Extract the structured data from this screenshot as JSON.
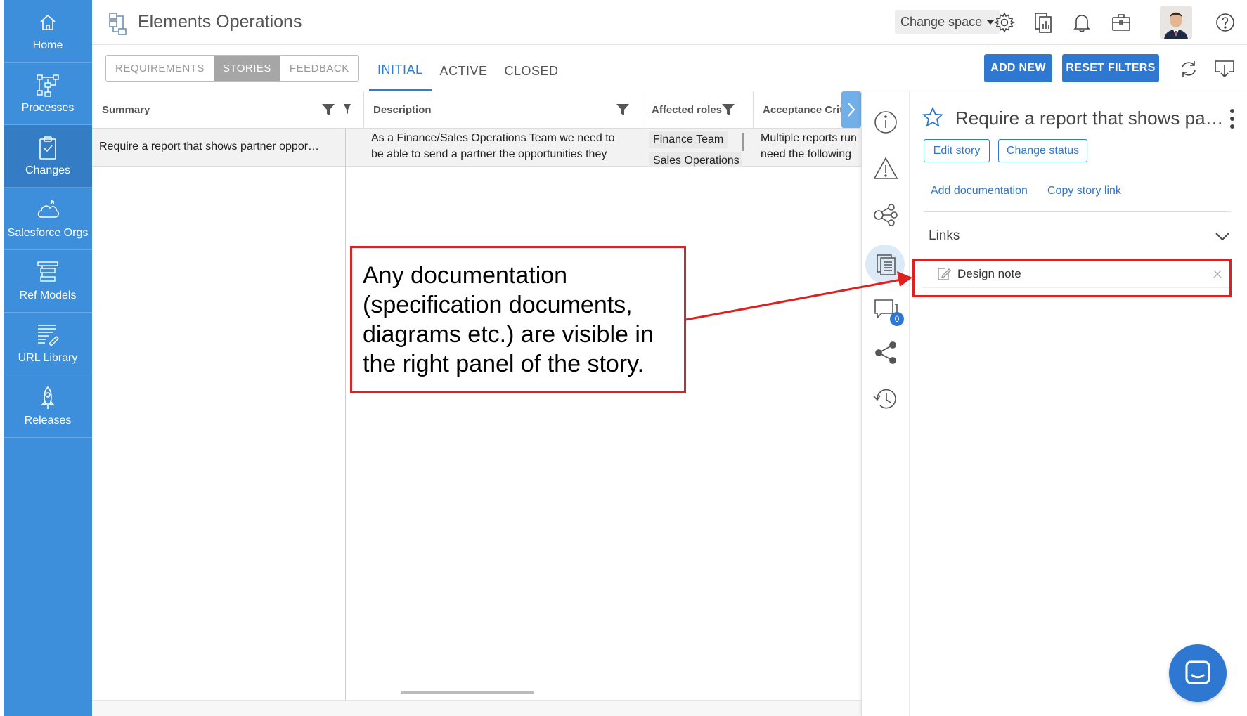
{
  "sidebar": {
    "items": [
      {
        "label": "Home",
        "icon": "home-icon"
      },
      {
        "label": "Processes",
        "icon": "processes-icon"
      },
      {
        "label": "Changes",
        "icon": "clipboard-check-icon",
        "active": true
      },
      {
        "label": "Salesforce Orgs",
        "icon": "cloud-icon"
      },
      {
        "label": "Ref Models",
        "icon": "ref-models-icon"
      },
      {
        "label": "URL Library",
        "icon": "url-library-icon"
      },
      {
        "label": "Releases",
        "icon": "rocket-icon"
      }
    ],
    "color": "#3d8fdc"
  },
  "header": {
    "title": "Elements Operations",
    "change_space": "Change space",
    "icons": [
      "gear-icon",
      "documents-icon",
      "bell-icon",
      "briefcase-icon",
      "avatar",
      "help-icon"
    ]
  },
  "toolbar": {
    "segments": [
      {
        "label": "REQUIREMENTS",
        "selected": false
      },
      {
        "label": "STORIES",
        "selected": true
      },
      {
        "label": "FEEDBACK",
        "selected": false
      }
    ],
    "tabs": [
      {
        "label": "INITIAL",
        "selected": true
      },
      {
        "label": "ACTIVE",
        "selected": false
      },
      {
        "label": "CLOSED",
        "selected": false
      }
    ],
    "add_new": "ADD NEW",
    "reset_filters": "RESET FILTERS",
    "accent": "#2f78d1"
  },
  "table": {
    "columns": [
      "Summary",
      "Description",
      "Affected roles",
      "Acceptance Criteri"
    ],
    "rows": [
      {
        "summary": "Require a report that shows partner oppor…",
        "description_line1": "As a Finance/Sales Operations Team we need to",
        "description_line2": "be able to send a partner the opportunities they",
        "role1": "Finance Team",
        "role2": "Sales Operations",
        "acceptance_line1": "Multiple reports run",
        "acceptance_line2": "need the following"
      }
    ]
  },
  "panel": {
    "story_title": "Require a report that shows partner opportunities",
    "edit_story": "Edit story",
    "change_status": "Change status",
    "add_documentation": "Add documentation",
    "copy_story_link": "Copy story link",
    "links_label": "Links",
    "links": [
      {
        "name": "Design note"
      }
    ],
    "comment_count": "0",
    "icons": [
      "info-icon",
      "warning-icon",
      "hierarchy-icon",
      "documents-icon",
      "comments-icon",
      "share-icon",
      "history-icon"
    ]
  },
  "annotation": {
    "text": "Any documentation (specification documents, diagrams etc.) are visible in the right panel of the story.",
    "color": "#e02020"
  }
}
